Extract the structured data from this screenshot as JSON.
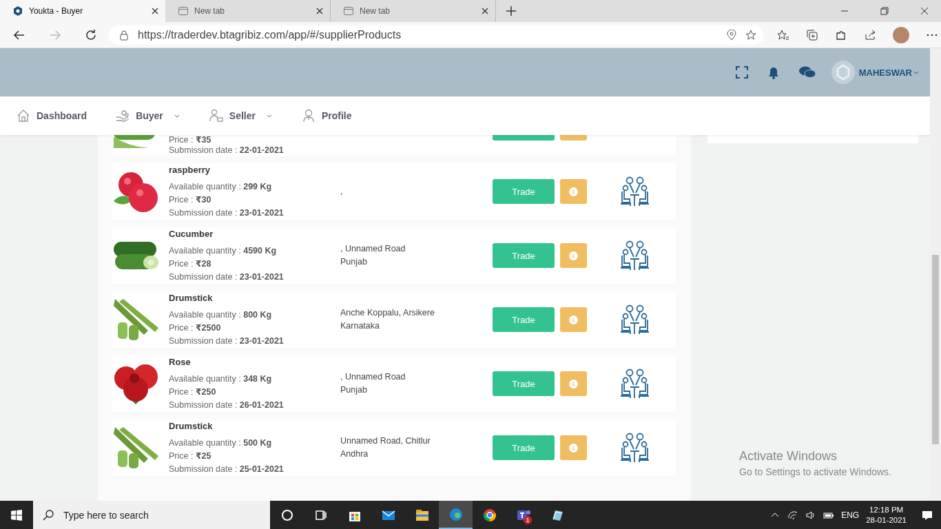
{
  "browser": {
    "tabs": [
      {
        "title": "Youkta - Buyer",
        "selected": true
      },
      {
        "title": "New tab",
        "selected": false
      },
      {
        "title": "New tab",
        "selected": false
      }
    ],
    "url": "https://traderdev.btagribiz.com/app/#/supplierProducts"
  },
  "header": {
    "user": "MAHESWAR"
  },
  "nav": [
    {
      "label": "Dashboard",
      "kind": "home",
      "dropdown": false
    },
    {
      "label": "Buyer",
      "kind": "buyer",
      "dropdown": true
    },
    {
      "label": "Seller",
      "kind": "seller",
      "dropdown": true
    },
    {
      "label": "Profile",
      "kind": "profile",
      "dropdown": false
    }
  ],
  "products": [
    {
      "partial": true,
      "price_label": "Price : ",
      "price": "₹35",
      "date_label": "Submission date : ",
      "date": "22-01-2021"
    },
    {
      "partial": false,
      "name": "raspberry",
      "qty_label": "Available quantity : ",
      "qty": "299 Kg",
      "price_label": "Price : ",
      "price": "₹30",
      "date_label": "Submission date : ",
      "date": "23-01-2021",
      "address": [
        ","
      ],
      "trade": "Trade"
    },
    {
      "partial": false,
      "name": "Cucumber",
      "qty_label": "Available quantity : ",
      "qty": "4590 Kg",
      "price_label": "Price : ",
      "price": "₹28",
      "date_label": "Submission date : ",
      "date": "23-01-2021",
      "address": [
        ", Unnamed Road",
        "Punjab"
      ],
      "trade": "Trade"
    },
    {
      "partial": false,
      "name": "Drumstick",
      "qty_label": "Available quantity : ",
      "qty": "800 Kg",
      "price_label": "Price : ",
      "price": "₹2500",
      "date_label": "Submission date : ",
      "date": "23-01-2021",
      "address": [
        "Anche Koppalu, Arsikere",
        "Karnataka"
      ],
      "trade": "Trade"
    },
    {
      "partial": false,
      "name": "Rose",
      "qty_label": "Available quantity : ",
      "qty": "348 Kg",
      "price_label": "Price : ",
      "price": "₹250",
      "date_label": "Submission date : ",
      "date": "26-01-2021",
      "address": [
        ", Unnamed Road",
        "Punjab"
      ],
      "trade": "Trade"
    },
    {
      "partial": false,
      "name": "Drumstick",
      "qty_label": "Available quantity : ",
      "qty": "500 Kg",
      "price_label": "Price : ",
      "price": "₹25",
      "date_label": "Submission date : ",
      "date": "25-01-2021",
      "address": [
        "Unnamed Road, Chitlur",
        "Andhra"
      ],
      "trade": "Trade"
    }
  ],
  "windows_notice": {
    "title": "Activate Windows",
    "text": "Go to Settings to activate Windows."
  },
  "taskbar": {
    "search_placeholder": "Type here to search",
    "apps": [
      {
        "kind": "cortana",
        "selected": false
      },
      {
        "kind": "taskview",
        "selected": false
      },
      {
        "kind": "store",
        "selected": false
      },
      {
        "kind": "mail",
        "selected": false
      },
      {
        "kind": "explorer",
        "selected": false
      },
      {
        "kind": "edge",
        "selected": true
      },
      {
        "kind": "chrome",
        "selected": false
      },
      {
        "kind": "teams",
        "selected": false,
        "badge": "1"
      },
      {
        "kind": "notes",
        "selected": false
      }
    ],
    "language": "ENG",
    "time": "12:18 PM",
    "date": "28-01-2021"
  }
}
